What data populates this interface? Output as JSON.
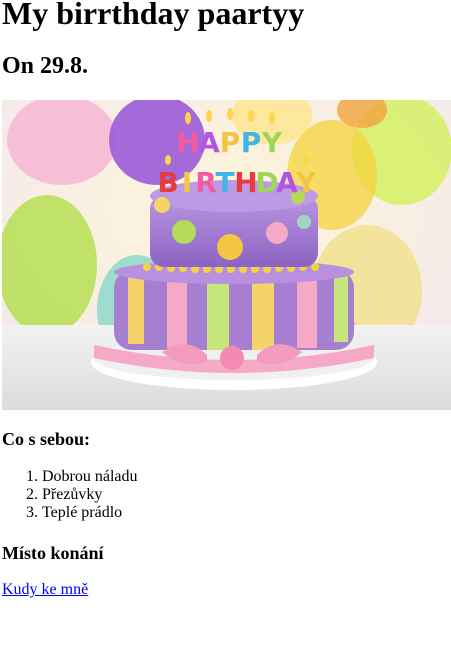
{
  "page": {
    "title": "My birrthday paartyy",
    "date_heading": "On 29.8.",
    "image": {
      "alt_description_icon": "birthday-cake-photo",
      "cake_topper_letters_top": [
        "H",
        "A",
        "P",
        "P",
        "Y"
      ],
      "cake_topper_letters_bottom": [
        "B",
        "I",
        "R",
        "T",
        "H",
        "D",
        "A",
        "Y"
      ]
    },
    "bring_heading": "Co s sebou:",
    "bring_items": [
      "Dobrou náladu",
      "Přezůvky",
      "Teplé prádlo"
    ],
    "venue_heading": "Místo konání",
    "venue_link": "Kudy ke mně"
  },
  "colors": {
    "link": "#0000ee",
    "cake_purple": "#a77fd0",
    "frosting_pink": "#f6a9c6",
    "balloon_green": "#b9e05a",
    "balloon_purple": "#9a5bd8",
    "balloon_yellow": "#f4d33c"
  }
}
